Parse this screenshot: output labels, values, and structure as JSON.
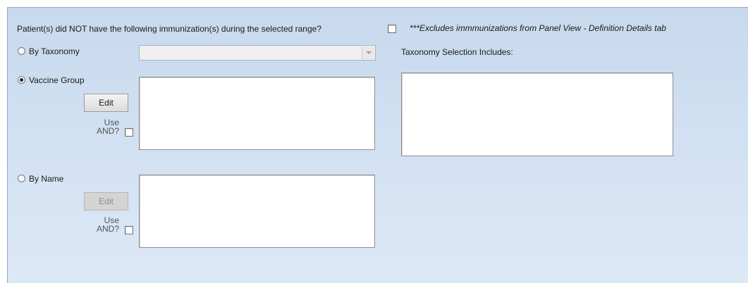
{
  "header": {
    "question": "Patient(s) did NOT have the following immunization(s) during the selected range?",
    "note": "***Excludes immmunizations from Panel View - Definition Details tab"
  },
  "taxonomy": {
    "radio_label": "By Taxonomy",
    "selected": false,
    "dropdown_value": "",
    "includes_label": "Taxonomy Selection Includes:"
  },
  "vaccine_group": {
    "radio_label": "Vaccine Group",
    "selected": true,
    "edit_label": "Edit",
    "use_label": "Use",
    "and_label": "AND?"
  },
  "by_name": {
    "radio_label": "By Name",
    "selected": false,
    "edit_label": "Edit",
    "use_label": "Use",
    "and_label": "AND?"
  }
}
